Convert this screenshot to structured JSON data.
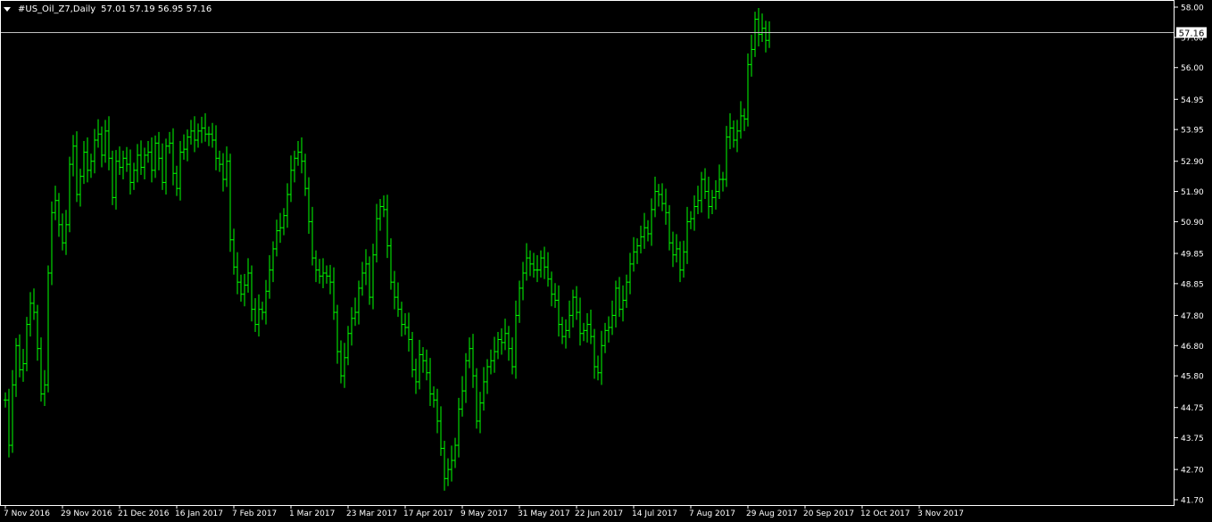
{
  "header": {
    "symbol_tf": "#US_Oil_Z7,Daily",
    "ohlc": "57.01 57.19 56.95 57.16"
  },
  "price_badge": "57.16",
  "colors": {
    "background": "#000000",
    "bars": "#00ff00",
    "axis": "#ffffff",
    "price_line": "#c0c0c0"
  },
  "chart_data": {
    "type": "ohlc",
    "title": "#US_Oil_Z7,Daily",
    "ylim": [
      41.7,
      58.0
    ],
    "yticks": [
      "58.00",
      "57.00",
      "56.00",
      "54.95",
      "53.95",
      "52.90",
      "51.90",
      "50.90",
      "49.85",
      "48.85",
      "47.80",
      "46.80",
      "45.80",
      "44.75",
      "43.75",
      "42.70",
      "41.70"
    ],
    "xticks": [
      "7 Nov 2016",
      "29 Nov 2016",
      "21 Dec 2016",
      "16 Jan 2017",
      "7 Feb 2017",
      "1 Mar 2017",
      "23 Mar 2017",
      "17 Apr 2017",
      "9 May 2017",
      "31 May 2017",
      "22 Jun 2017",
      "14 Jul 2017",
      "7 Aug 2017",
      "29 Aug 2017",
      "20 Sep 2017",
      "12 Oct 2017",
      "3 Nov 2017"
    ],
    "xtick_index": [
      0,
      16,
      32,
      48,
      64,
      80,
      96,
      112,
      128,
      144,
      160,
      176,
      192,
      208,
      224,
      240,
      256
    ],
    "current_price": 57.16,
    "close": [
      45.0,
      43.5,
      45.5,
      46.8,
      46.0,
      46.2,
      47.5,
      48.2,
      47.9,
      46.7,
      45.2,
      45.5,
      49.2,
      51.2,
      51.6,
      50.8,
      50.2,
      50.8,
      52.8,
      53.4,
      51.8,
      52.4,
      53.2,
      52.6,
      52.9,
      53.6,
      53.8,
      53.1,
      53.9,
      53.0,
      51.7,
      52.9,
      52.7,
      53.0,
      52.8,
      52.2,
      52.6,
      53.1,
      52.7,
      53.1,
      53.2,
      52.6,
      53.5,
      53.0,
      52.2,
      53.4,
      53.5,
      52.5,
      52.0,
      53.2,
      53.3,
      53.7,
      53.9,
      53.6,
      53.9,
      54.0,
      53.8,
      53.8,
      53.6,
      53.0,
      52.8,
      52.3,
      52.9,
      50.3,
      49.4,
      48.9,
      48.5,
      48.8,
      49.2,
      48.0,
      47.5,
      48.0,
      47.9,
      48.6,
      49.3,
      50.0,
      50.6,
      50.7,
      51.1,
      51.8,
      52.6,
      53.0,
      53.2,
      52.9,
      52.0,
      50.9,
      49.7,
      49.3,
      49.1,
      49.2,
      49.1,
      48.9,
      47.9,
      46.6,
      45.8,
      46.4,
      47.2,
      47.7,
      47.9,
      48.7,
      49.2,
      49.5,
      48.4,
      49.8,
      51.0,
      51.4,
      51.3,
      50.1,
      48.9,
      48.4,
      48.0,
      47.5,
      47.4,
      47.0,
      46.0,
      45.6,
      46.5,
      46.3,
      45.9,
      45.2,
      45.0,
      44.3,
      43.4,
      42.4,
      42.7,
      43.0,
      43.5,
      44.7,
      45.3,
      46.3,
      46.7,
      45.8,
      44.3,
      44.9,
      45.6,
      46.1,
      46.3,
      46.6,
      47.0,
      46.9,
      47.2,
      46.7,
      46.1,
      47.8,
      48.7,
      49.2,
      49.7,
      49.5,
      49.3,
      49.3,
      49.7,
      49.4,
      49.0,
      48.5,
      48.3,
      47.5,
      47.1,
      47.3,
      47.8,
      48.4,
      47.9,
      47.2,
      47.3,
      47.5,
      47.1,
      46.1,
      45.9,
      46.8,
      47.3,
      47.4,
      47.8,
      48.7,
      48.0,
      48.3,
      48.9,
      49.5,
      49.9,
      50.1,
      50.4,
      50.7,
      50.5,
      51.3,
      51.9,
      51.8,
      51.5,
      51.2,
      50.2,
      49.8,
      50.0,
      49.3,
      49.9,
      50.9,
      51.0,
      51.4,
      51.6,
      52.3,
      51.9,
      51.4,
      51.7,
      51.9,
      52.3,
      52.3,
      53.7,
      54.0,
      53.6,
      53.9,
      54.4,
      54.3,
      56.1,
      56.6,
      57.6,
      57.1,
      57.3,
      56.9,
      57.16
    ],
    "note_series_order": "chronological daily bars"
  }
}
